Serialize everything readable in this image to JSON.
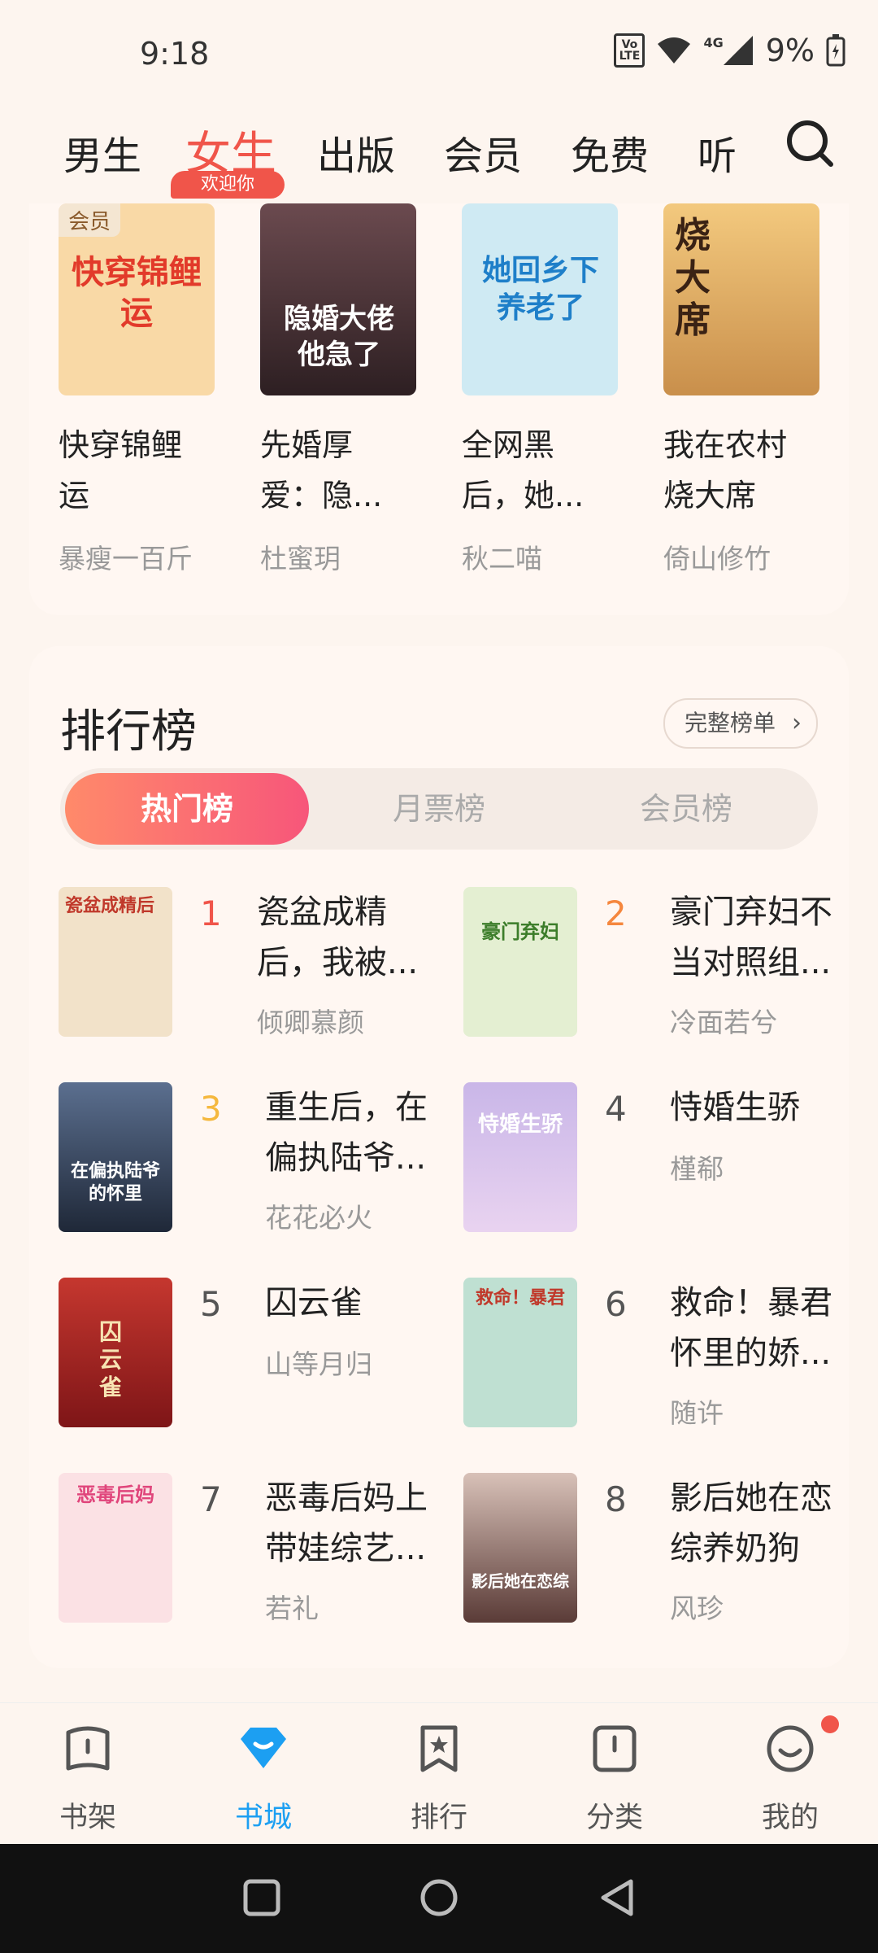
{
  "status": {
    "time": "9:18",
    "volte": "VoLTE",
    "network": "4G",
    "battery": "9%"
  },
  "top_tabs": [
    "男生",
    "女生",
    "出版",
    "会员",
    "免费",
    "听书"
  ],
  "welcome_badge": "欢迎你",
  "top_books": [
    {
      "title_line1": "快穿锦鲤",
      "title_line2": "运",
      "author": "暴瘦一百斤",
      "tag": "会员",
      "cover_text": "快穿锦鲤运",
      "cover_color": "#f9d9a6"
    },
    {
      "title_line1": "先婚厚",
      "title_line2": "爱：隐...",
      "author": "杜蜜玥",
      "cover_text": "隐婚大佬他急了",
      "cover_color": "#3a2a2e"
    },
    {
      "title_line1": "全网黑",
      "title_line2": "后，她...",
      "author": "秋二喵",
      "cover_text": "她回乡下养老了",
      "cover_color": "#cfeaf3"
    },
    {
      "title_line1": "我在农村",
      "title_line2": "烧大席",
      "author": "倚山修竹",
      "cover_text": "烧大席",
      "cover_color": "#f3c97e"
    }
  ],
  "ranking": {
    "title": "排行榜",
    "full_list": "完整榜单",
    "segments": [
      "热门榜",
      "月票榜",
      "会员榜"
    ],
    "items": [
      {
        "rank": "1",
        "title_line1": "瓷盆成精",
        "title_line2": "后，我被...",
        "author": "倾卿慕颜",
        "rank_color": "#f0554a",
        "cover_text": "瓷盆成精后",
        "cover_color": "#f2e2c9"
      },
      {
        "rank": "2",
        "title_line1": "豪门弃妇不",
        "title_line2": "当对照组...",
        "author": "冷面若兮",
        "rank_color": "#f5873e",
        "cover_text": "豪门弃妇",
        "cover_color": "#e4efd2"
      },
      {
        "rank": "3",
        "title_line1": "重生后，在",
        "title_line2": "偏执陆爷...",
        "author": "花花必火",
        "rank_color": "#f5b83e",
        "cover_text": "在偏执陆爷的怀里",
        "cover_color": "#2e3d55"
      },
      {
        "rank": "4",
        "title_line1": "恃婚生骄",
        "title_line2": "",
        "author": "槿郗",
        "rank_color": "#555555",
        "cover_text": "恃婚生骄",
        "cover_color": "#c9b6e8"
      },
      {
        "rank": "5",
        "title_line1": "囚云雀",
        "title_line2": "",
        "author": "山等月归",
        "rank_color": "#555555",
        "cover_text": "囚云雀",
        "cover_color": "#b0282a"
      },
      {
        "rank": "6",
        "title_line1": "救命！暴君",
        "title_line2": "怀里的娇...",
        "author": "随许",
        "rank_color": "#555555",
        "cover_text": "救命！暴君",
        "cover_color": "#bfe0d2"
      },
      {
        "rank": "7",
        "title_line1": "恶毒后妈上",
        "title_line2": "带娃综艺...",
        "author": "若礼",
        "rank_color": "#555555",
        "cover_text": "恶毒后妈",
        "cover_color": "#fbe1e4"
      },
      {
        "rank": "8",
        "title_line1": "影后她在恋",
        "title_line2": "综养奶狗",
        "author": "风珍",
        "rank_color": "#555555",
        "cover_text": "影后她在恋综",
        "cover_color": "#7a5b56"
      }
    ]
  },
  "bottom_nav": [
    "书架",
    "书城",
    "排行",
    "分类",
    "我的"
  ],
  "colors": {
    "accent_red": "#f0554a",
    "accent_blue": "#1c9ff2",
    "background": "#fdf5ef"
  }
}
